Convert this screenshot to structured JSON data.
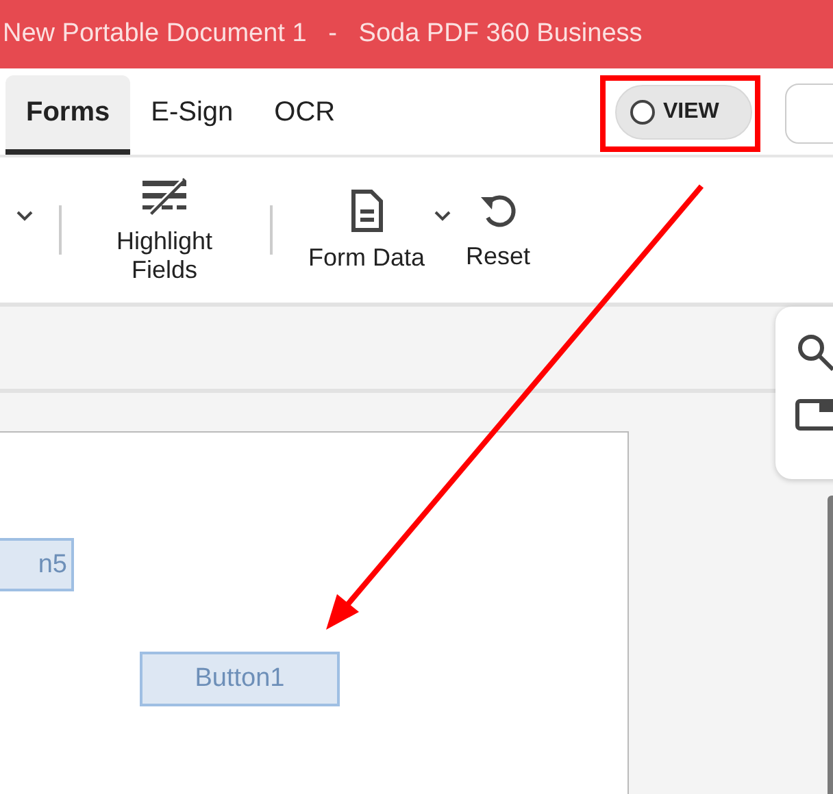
{
  "window": {
    "title": "New Portable Document 1   -   Soda PDF 360 Business"
  },
  "tabs": [
    {
      "label": "Forms",
      "selected": true
    },
    {
      "label": "E-Sign",
      "selected": false
    },
    {
      "label": "OCR",
      "selected": false
    }
  ],
  "view_toggle": {
    "label": "VIEW",
    "on": false
  },
  "tools": [
    {
      "kind": "highlight",
      "label": "Highlight Fields",
      "has_dropdown": false
    },
    {
      "kind": "form-data",
      "label": "Form Data",
      "has_dropdown": true
    },
    {
      "kind": "reset",
      "label": "Reset",
      "has_dropdown": false
    }
  ],
  "page_fields": [
    {
      "label": "n5"
    },
    {
      "label": "Button1"
    }
  ]
}
